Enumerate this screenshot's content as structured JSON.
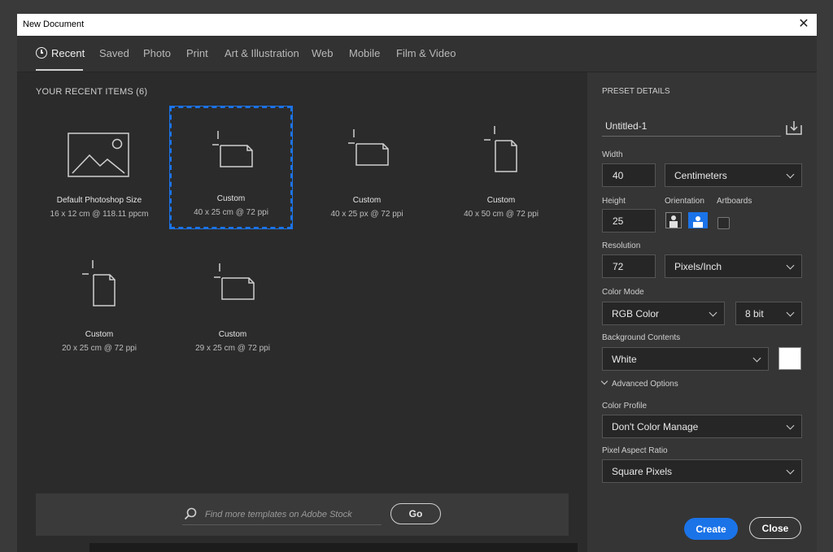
{
  "window": {
    "title": "New Document",
    "close_glyph": "✕"
  },
  "tabs": [
    {
      "label": "Recent"
    },
    {
      "label": "Saved"
    },
    {
      "label": "Photo"
    },
    {
      "label": "Print"
    },
    {
      "label": "Art & Illustration"
    },
    {
      "label": "Web"
    },
    {
      "label": "Mobile"
    },
    {
      "label": "Film & Video"
    }
  ],
  "recent": {
    "heading": "YOUR RECENT ITEMS  (6)",
    "items": [
      {
        "name": "Default Photoshop Size",
        "desc": "16 x 12 cm @ 118.11 ppcm",
        "icon": "image-icon"
      },
      {
        "name": "Custom",
        "desc": "40 x 25 cm @ 72 ppi",
        "icon": "landscape-document-icon",
        "selected": true
      },
      {
        "name": "Custom",
        "desc": "40 x 25 px @ 72 ppi",
        "icon": "landscape-document-icon"
      },
      {
        "name": "Custom",
        "desc": "40 x 50 cm @ 72 ppi",
        "icon": "portrait-document-icon"
      },
      {
        "name": "Custom",
        "desc": "20 x 25 cm @ 72 ppi",
        "icon": "portrait-document-icon"
      },
      {
        "name": "Custom",
        "desc": "29 x 25 cm @ 72 ppi",
        "icon": "landscape-document-icon"
      }
    ]
  },
  "search": {
    "placeholder": "Find more templates on Adobe Stock",
    "go_label": "Go"
  },
  "preset": {
    "heading": "PRESET DETAILS",
    "name": "Untitled-1",
    "width_label": "Width",
    "width_value": "40",
    "width_unit": "Centimeters",
    "height_label": "Height",
    "height_value": "25",
    "orientation_label": "Orientation",
    "orientation_selected": "landscape",
    "artboards_label": "Artboards",
    "artboards_checked": false,
    "resolution_label": "Resolution",
    "resolution_value": "72",
    "resolution_unit": "Pixels/Inch",
    "color_mode_label": "Color Mode",
    "color_mode": "RGB Color",
    "bit_depth": "8 bit",
    "background_label": "Background Contents",
    "background": "White",
    "background_color": "#ffffff",
    "advanced_label": "Advanced Options",
    "color_profile_label": "Color Profile",
    "color_profile": "Don't Color Manage",
    "pixel_aspect_label": "Pixel Aspect Ratio",
    "pixel_aspect": "Square Pixels"
  },
  "actions": {
    "create_label": "Create",
    "close_label": "Close"
  },
  "colors": {
    "accent": "#1b73e8",
    "panel": "#2b2b2b",
    "sidebar": "#353535"
  }
}
